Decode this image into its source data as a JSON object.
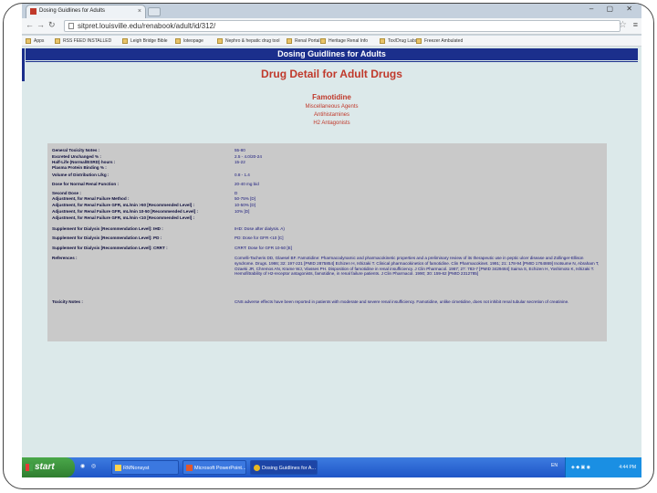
{
  "browser": {
    "tab_title": "Dosing Guidlines for Adults",
    "tab_close": "×",
    "window_controls": "– ▢ ✕",
    "url": "sitpret.louisville.edu/renabook/adult/id/312/",
    "bookmarks": [
      "Apps",
      "RSS FEED INSTALLED",
      "Leigh Bridge Bible",
      "loteopage",
      "Nephro & hepatic drug tool",
      "Renal Portal",
      "Heritage Renal Info",
      "Tox/Drug Labs",
      "Freezer Ambulated"
    ]
  },
  "page": {
    "header": "Dosing Guidlines for Adults",
    "title": "Drug Detail for Adult Drugs",
    "drug_name": "Famotidine",
    "classes": [
      "Miscellaneous Agents",
      "Antihistamines",
      "H2 Antagonists"
    ]
  },
  "details": [
    {
      "label": "General Toxicity Notes :",
      "value": "55-80"
    },
    {
      "label": "Excreted Unchanged % :",
      "value": "2.5 - 4.0/20-24"
    },
    {
      "label": "Half-Life (Normal/ESRD) hours :",
      "value": "15-22"
    },
    {
      "label": "Plasma Protein Binding % :",
      "value": ""
    },
    {
      "label": "Volume of Distribution L/kg :",
      "value": "0.8 - 1.4"
    },
    {
      "label": "Dose for Normal Renal Function :",
      "value": "20-40 mg bid"
    },
    {
      "label": "Second Dose :",
      "value": "D"
    },
    {
      "label": "Adjustment, for Renal Failure Method :",
      "value": "50-75% [D]"
    },
    {
      "label": "Adjustment, for Renal Failure GFR, mL/min >50 [Recommended Level] :",
      "value": "10-50% [D]"
    },
    {
      "label": "Adjustment, for Renal Failure GFR, mL/min 10-50 [Recommended Level] :",
      "value": "10% [D]"
    },
    {
      "label": "Adjustment, for Renal Failure GFR, mL/min <10 [Recommended Level] :",
      "value": ""
    },
    {
      "label": "Supplement for Dialysis [Recommendation Level]: IHD :",
      "value": "IHD: Dose after dialysis. A)"
    },
    {
      "label": "Supplement for Dialysis [Recommendation Level]: PD :",
      "value": "PD: Dose for GFR <10 [C]"
    },
    {
      "label": "Supplement for Dialysis [Recommendation Level]: CRRT :",
      "value": "CRRT: Dose for GFR 10-50 [E]"
    },
    {
      "label": "References :",
      "value": "Cornelli-Tacheris DD, Glaesel BF. Famotidine: Pharmacodynamic and pharmacokinetic properties and a preliminary review of its therapeutic use in peptic ulcer disease and Zollinger-Ellison syndrome. Drugs. 1986; 32: 197-221 [PMID 2875854] Echizen H, Ishizaki T. Clinical pharmacokinetics of famotidine. Clin Pharmacokinet. 1991; 21: 178-94 [PMID 1764869] Inotsume N, Abraham T, Ozaeki JR, Chremos AN, Krame WJ, Vlasses PH. Disposition of famotidine in renal insufficiency. J Clin Pharmacol. 1987; 27: 783-7 [PMID 3429484] Saima S, Echizen H, Yoshimoto K, Ishizaki T. Hemofiltrability of H2-receptor antagonists, famotidine, in renal failure patients. J Clin Pharmacol. 1990; 30: 159-62 [PMID 2312785]"
    },
    {
      "label": "Toxicity Notes :",
      "value": "CNS adverse effects have been reported in patients with moderate and severe renal insufficiency. Famotidine, unlike cimetidine, does not inhibit renal tubular secretion of creatinine."
    }
  ],
  "taskbar": {
    "start": "start",
    "buttons": [
      "RMNonsyst",
      "Microsoft PowerPoint...",
      "Dosing Guidlines for A..."
    ],
    "lang": "EN",
    "clock": "4:44 PM"
  }
}
